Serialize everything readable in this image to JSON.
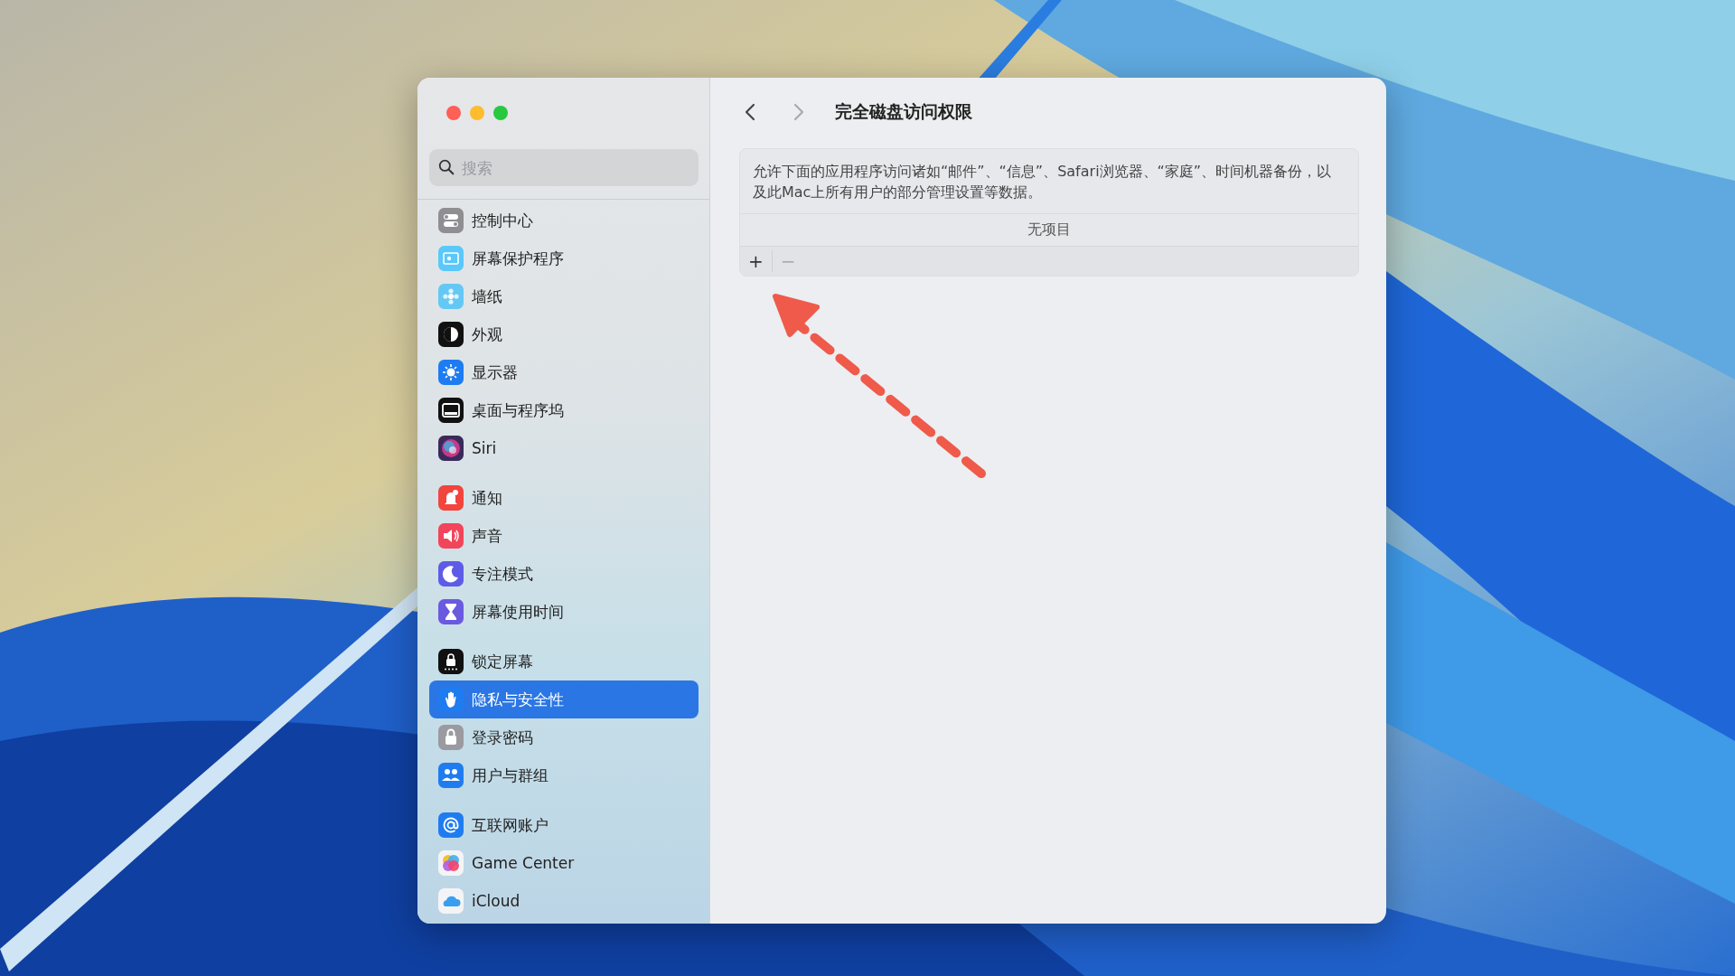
{
  "window": {
    "title": "完全磁盘访问权限"
  },
  "sidebar": {
    "search": {
      "placeholder": "搜索"
    },
    "groups": [
      [
        {
          "label": "控制中心",
          "kind": "controls",
          "selected": false
        },
        {
          "label": "屏幕保护程序",
          "kind": "screensaver",
          "selected": false
        },
        {
          "label": "墙纸",
          "kind": "wallpaper",
          "selected": false
        },
        {
          "label": "外观",
          "kind": "appearance",
          "selected": false
        },
        {
          "label": "显示器",
          "kind": "display",
          "selected": false
        },
        {
          "label": "桌面与程序坞",
          "kind": "dock",
          "selected": false
        },
        {
          "label": "Siri",
          "kind": "siri",
          "selected": false
        }
      ],
      [
        {
          "label": "通知",
          "kind": "notifications",
          "selected": false
        },
        {
          "label": "声音",
          "kind": "sound",
          "selected": false
        },
        {
          "label": "专注模式",
          "kind": "focus",
          "selected": false
        },
        {
          "label": "屏幕使用时间",
          "kind": "screentime",
          "selected": false
        }
      ],
      [
        {
          "label": "锁定屏幕",
          "kind": "lock",
          "selected": false
        },
        {
          "label": "隐私与安全性",
          "kind": "privacy",
          "selected": true
        },
        {
          "label": "登录密码",
          "kind": "password",
          "selected": false
        },
        {
          "label": "用户与群组",
          "kind": "users",
          "selected": false
        }
      ],
      [
        {
          "label": "互联网账户",
          "kind": "internet",
          "selected": false
        },
        {
          "label": "Game Center",
          "kind": "gamecenter",
          "selected": false
        },
        {
          "label": "iCloud",
          "kind": "icloud",
          "selected": false
        }
      ]
    ]
  },
  "content": {
    "description": "允许下面的应用程序访问诸如“邮件”、“信息”、Safari浏览器、“家庭”、时间机器备份，以及此Mac上所有用户的部分管理设置等数据。",
    "empty_label": "无项目",
    "buttons": [
      "+",
      "−"
    ]
  }
}
